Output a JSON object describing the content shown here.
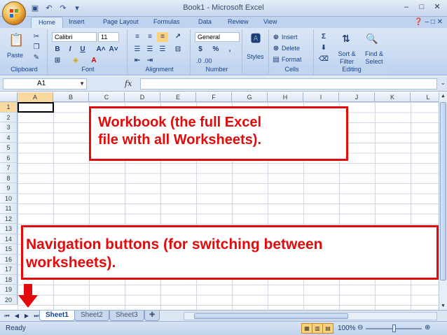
{
  "window": {
    "title": "Book1 - Microsoft Excel",
    "controls": [
      "–",
      "□",
      "✕"
    ]
  },
  "ribbon": {
    "tabs": [
      "Home",
      "Insert",
      "Page Layout",
      "Formulas",
      "Data",
      "Review",
      "View"
    ],
    "active_tab": "Home",
    "clipboard": {
      "paste_label": "Paste",
      "group_label": "Clipboard"
    },
    "font": {
      "name": "Calibri",
      "size": "11",
      "bold": "B",
      "italic": "I",
      "underline": "U",
      "grow": "A˄",
      "shrink": "A˅",
      "group_label": "Font"
    },
    "alignment": {
      "group_label": "Alignment"
    },
    "number": {
      "format": "General",
      "currency": "$",
      "percent": "%",
      "comma": ",",
      "inc_dec": ".0 .00",
      "group_label": "Number"
    },
    "styles": {
      "label": "Styles",
      "group_label": "Styles"
    },
    "cells": {
      "insert": "Insert",
      "delete": "Delete",
      "format": "Format",
      "group_label": "Cells"
    },
    "editing": {
      "sum": "Σ",
      "sort_filter": "Sort & Filter",
      "find_select": "Find & Select",
      "group_label": "Editing"
    }
  },
  "formula_bar": {
    "name_box": "A1",
    "fx_label": "fx",
    "formula": ""
  },
  "grid": {
    "columns": [
      "A",
      "B",
      "C",
      "D",
      "E",
      "F",
      "G",
      "H",
      "I",
      "J",
      "K",
      "L"
    ],
    "rows": [
      "1",
      "2",
      "3",
      "4",
      "5",
      "6",
      "7",
      "8",
      "9",
      "10",
      "11",
      "12",
      "13",
      "14",
      "15",
      "16",
      "17",
      "18",
      "19",
      "20"
    ],
    "active_cell": "A1"
  },
  "sheets": {
    "tabs": [
      "Sheet1",
      "Sheet2",
      "Sheet3"
    ],
    "active": "Sheet1"
  },
  "status": {
    "text": "Ready",
    "zoom": "100%"
  },
  "annotations": {
    "workbook_line1": "Workbook (the full Excel",
    "workbook_line2": "file with all Worksheets).",
    "nav_line1": "Navigation buttons (for switching between",
    "nav_line2": "worksheets).",
    "color": "#e20a0a"
  }
}
